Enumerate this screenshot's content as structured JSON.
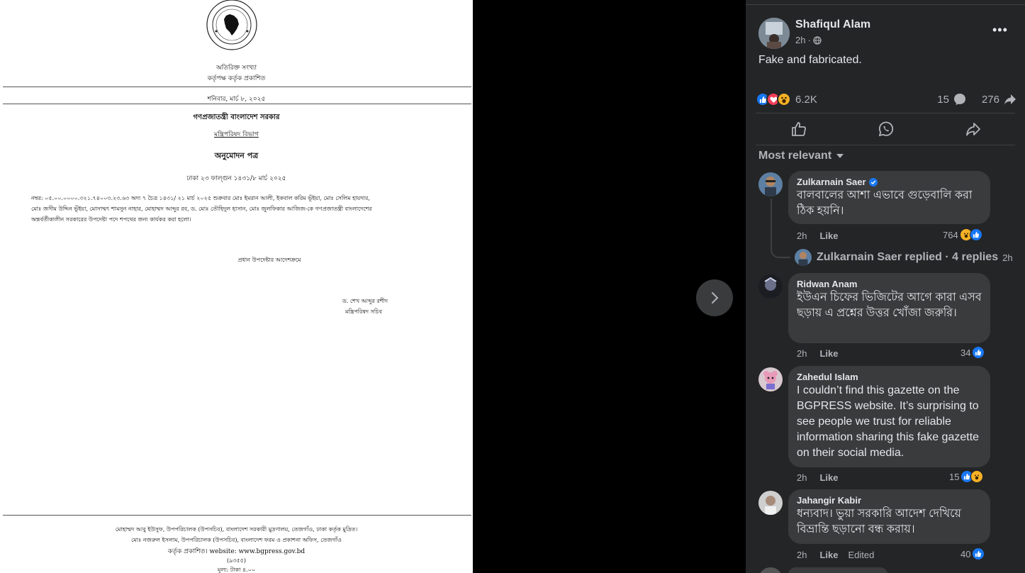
{
  "document": {
    "header_line1": "অতিরিক্ত সংখ্যা",
    "header_line2": "কর্তৃপক্ষ কর্তৃক প্রকাশিত",
    "date_line": "শনিবার, মার্চ ৮, ২০২৫",
    "gov_title": "গণপ্রজাতন্ত্রী বাংলাদেশ সরকার",
    "division": "মন্ত্রিপরিষদ বিভাগ",
    "doc_type": "অনুমোদন পত্র",
    "place_date": "ঢাকা ২৩ ফাল্গুন ১৪৩১/৮ মার্চ ২০২৫",
    "body_line1": "নম্বর: ০৫.০০.০০০০.৩২১.৭৪০০৩.২৩.৬৩ অদ্য ৭ চৈত্র ১৪৩১/ ২১ মার্চ ২০২৫ শুক্রবার মোঃ ইমরান আলী, ইকবাল করিম ভূঁইয়া, মোঃ সেলিম হায়দার,",
    "body_line2": "মোঃ জসীম উদ্দিন ভূঁইয়া, মোসাম্মৎ শামসুন নাহার, মোহাম্মদ আব্দুর রব, ড. মোঃ তৌহিদুল হাসান, মোঃ জুলফিকার আজিজ-কে গণপ্রজাতন্ত্রী বাংলাদেশের",
    "body_line3": "অন্তর্বর্তীকালীন সরকারের উপদেষ্টা পদে শপথের জন্য কার্যকর করা হলো।",
    "order_line": "প্রধান উপদেষ্টার আদেশক্রমে",
    "signer_name": "ড. শেখ আব্দুর রশীদ",
    "signer_title": "মন্ত্রিপরিষদ সচিব",
    "footer_line1": "মোহাম্মদ আবু ইউসুফ, উপপরিচালক (উপসচিব), বাংলাদেশ সরকারী মুদ্রণালয়, তেজগাঁও, ঢাকা কর্তৃক মুদ্রিত।",
    "footer_line2": "মোঃ নজরুল ইসলাম, উপপরিচালক (উপসচিব), বাংলাদেশ ফরম ও প্রকাশনা অফিস, তেজগাঁও",
    "footer_line3": "কর্তৃক প্রকাশিত। website: www.bgpress.gov.bd",
    "footer_line4": "(৯৩৫৫)",
    "footer_line5": "মূল্য: টাকা ৪.০০"
  },
  "post": {
    "author": "Shafiqul Alam",
    "time": "2h",
    "separator": "·",
    "text": "Fake and fabricated.",
    "reaction_count": "6.2K",
    "comment_count": "15",
    "share_count": "276",
    "sort_label": "Most relevant"
  },
  "comments": [
    {
      "name": "Zulkarnain Saer",
      "verified": true,
      "text": "বালবালের আশা এভাবে গুড়েবালি করা ঠিক হয়নি।",
      "time": "2h",
      "like": "Like",
      "count": "764"
    },
    {
      "name": "Ridwan Anam",
      "text": "ইউএন চিফের ভিজিটের আগে কারা এসব ছড়ায় এ প্রশ্নের উত্তর খোঁজা জরুরি।",
      "time": "2h",
      "like": "Like",
      "count": "34"
    },
    {
      "name": "Zahedul Islam",
      "text": "I couldn’t find this gazette on the BGPRESS website. It’s surprising to see people we trust for reliable information sharing this fake gazette on their social media.",
      "time": "2h",
      "like": "Like",
      "count": "15"
    },
    {
      "name": "Jahangir Kabir",
      "text": "ধন্যবাদ। ভুয়া সরকারি আদেশ দেখিয়ে বিভ্রান্তি ছড়ানো বন্ধ করায়।",
      "time": "2h",
      "like": "Like",
      "edited": "Edited",
      "count": "40"
    }
  ],
  "replies": {
    "label": "Zulkarnain Saer replied · 4 replies",
    "time": "2h"
  },
  "colors": {
    "panel_bg": "#242526",
    "bubble_bg": "#3a3b3c",
    "like_blue": "#1877f2",
    "love_red": "#f33e58",
    "haha_yellow": "#f7b125"
  },
  "icons": [
    "globe-icon",
    "more-icon",
    "like-icon",
    "love-icon",
    "haha-icon",
    "comment-icon",
    "share-icon",
    "whatsapp-icon",
    "chevron-right-icon",
    "caret-down-icon",
    "verified-icon"
  ]
}
